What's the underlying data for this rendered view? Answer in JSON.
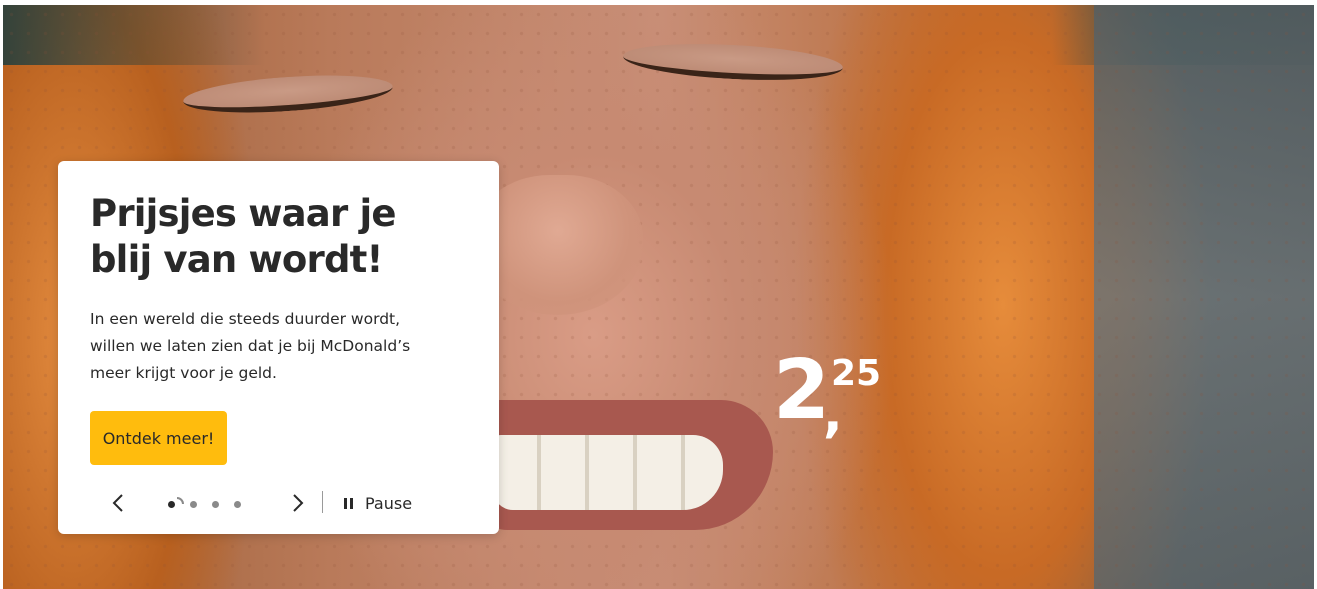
{
  "hero": {
    "title": "Prijsjes waar je blij van wordt!",
    "body": "In een wereld die steeds duurder wordt, willen we laten zien dat je bij McDonald’s meer krijgt voor je geld.",
    "cta_label": "Ontdek meer!",
    "price": {
      "euros": "2",
      "separator": ",",
      "cents": "25"
    }
  },
  "carousel": {
    "pause_label": "Pause",
    "slide_count": 4,
    "active_slide": 1
  },
  "colors": {
    "accent": "#ffbc0d",
    "text": "#292929",
    "card_bg": "#ffffff"
  },
  "icons": {
    "prev": "chevron-left-icon",
    "next": "chevron-right-icon",
    "pause": "pause-icon"
  }
}
